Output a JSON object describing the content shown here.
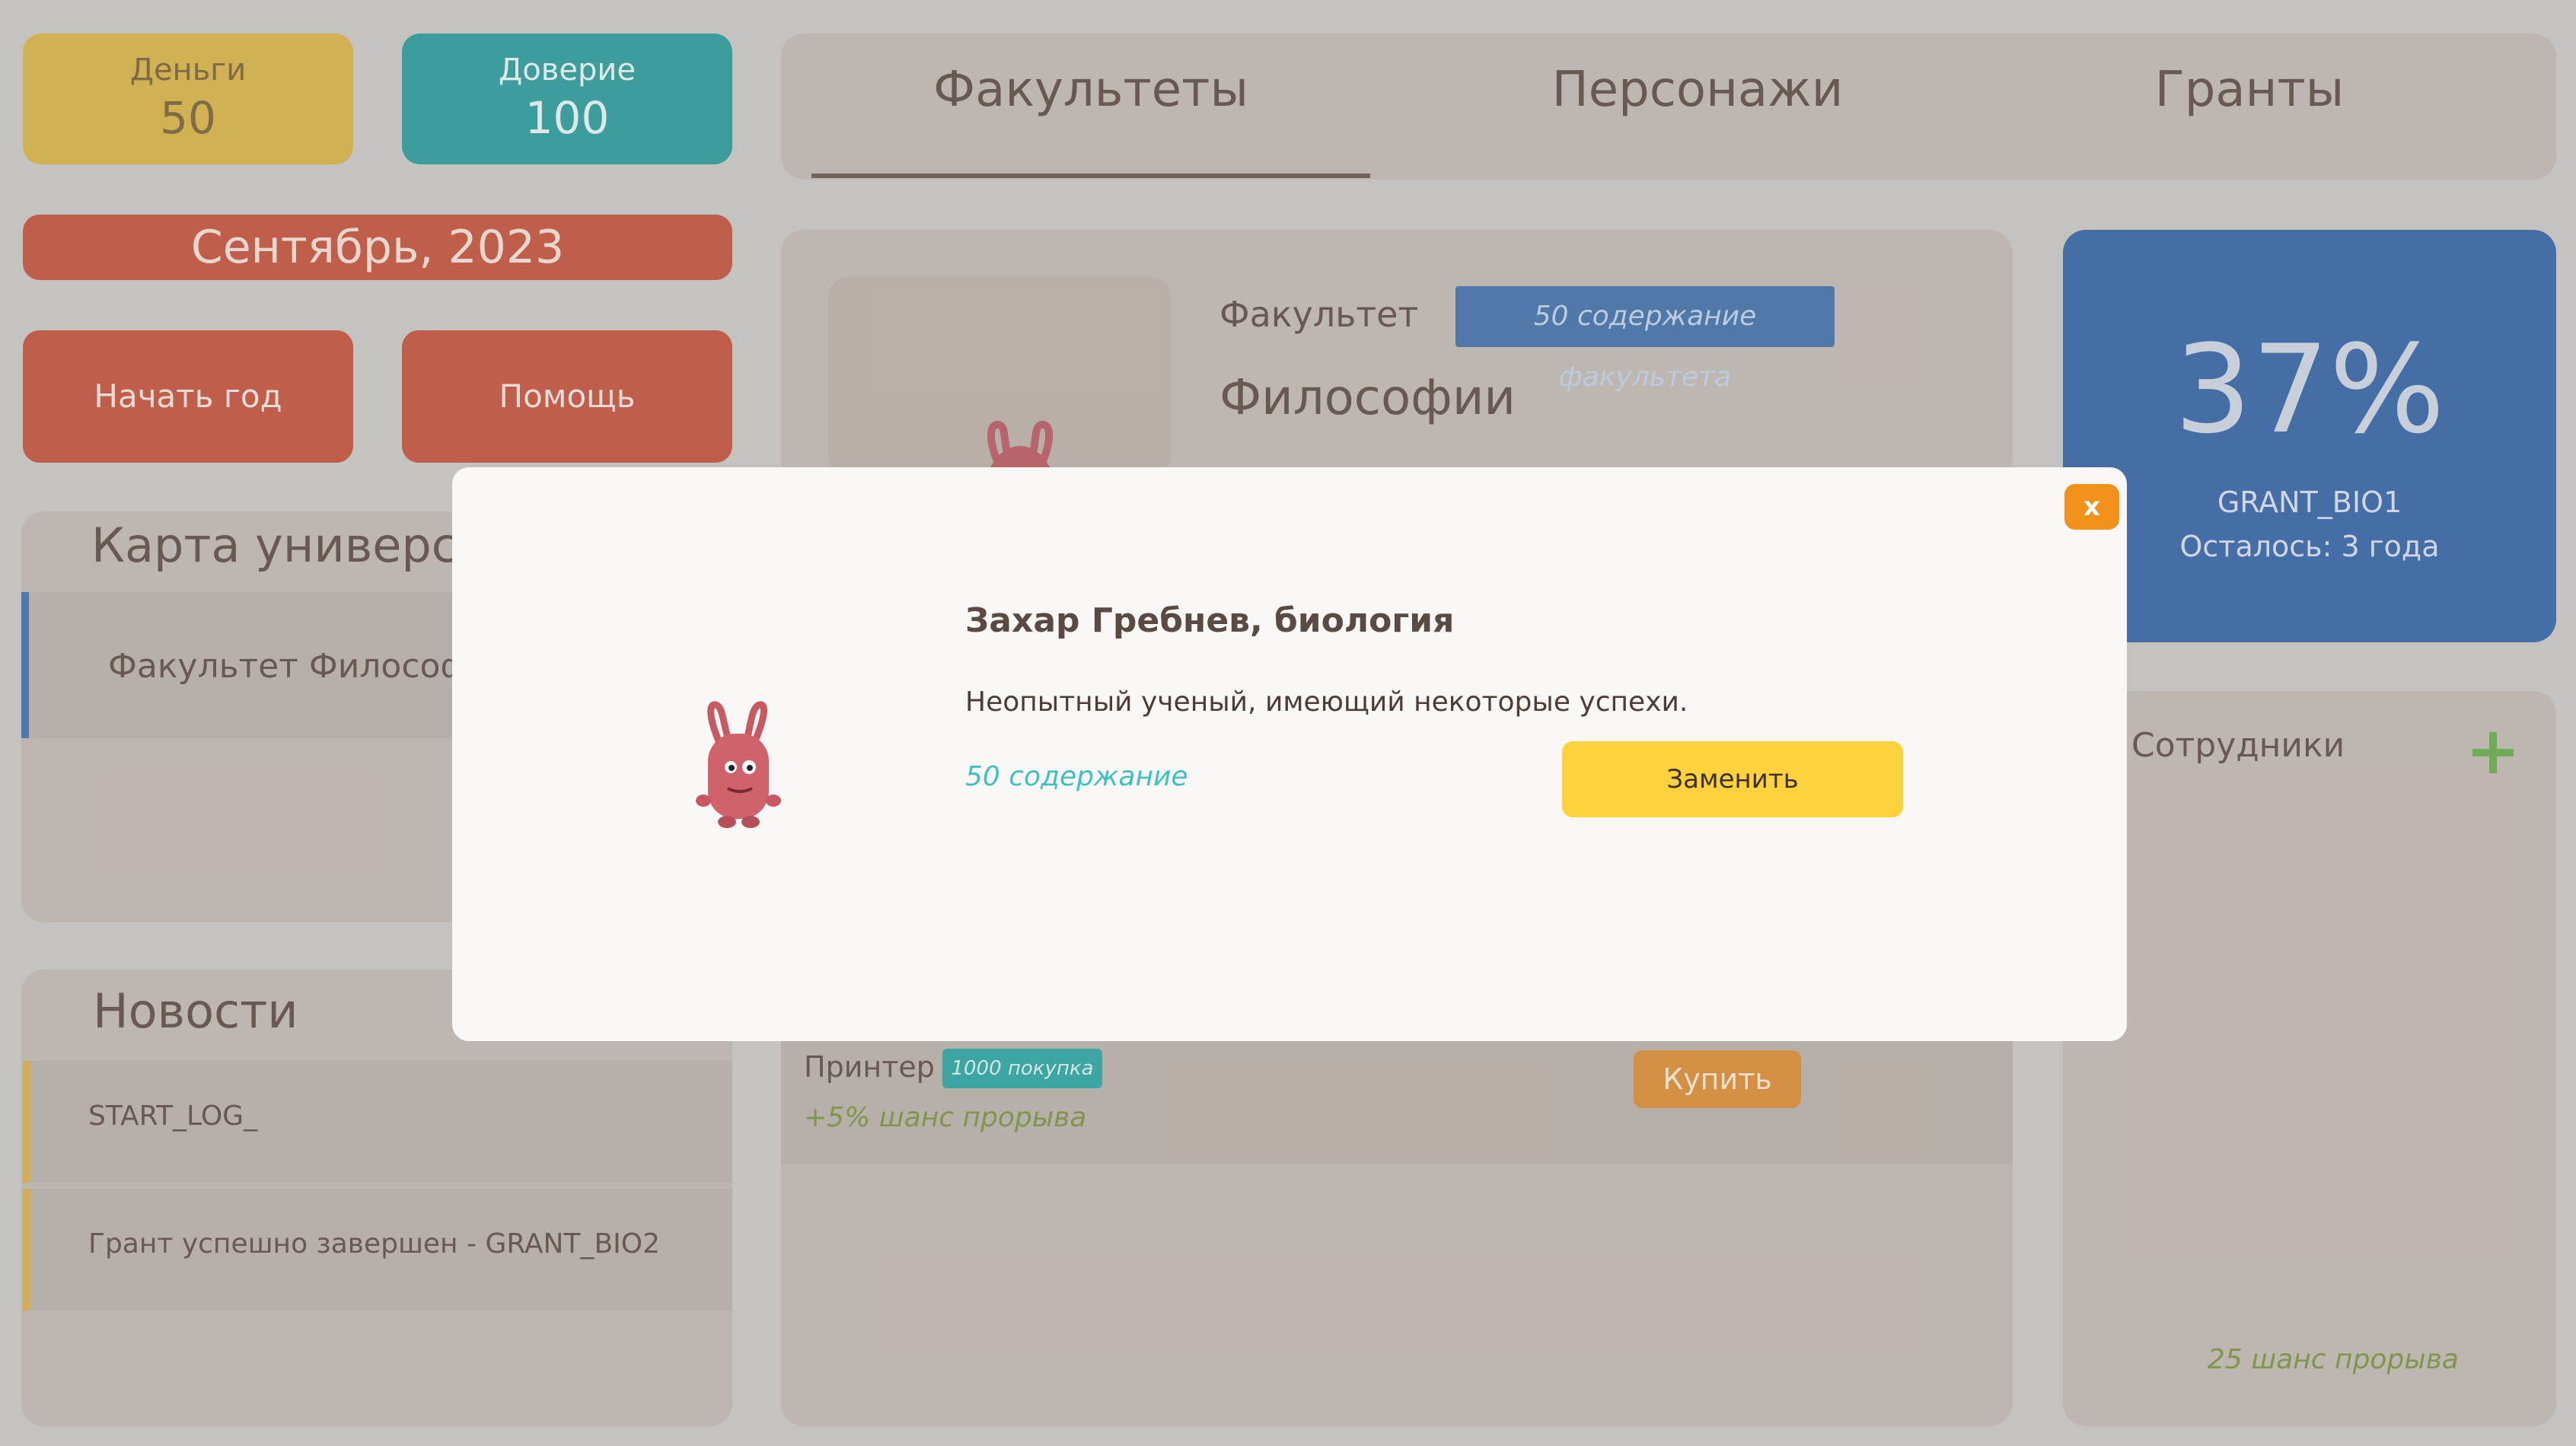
{
  "stats": {
    "money_label": "Деньги",
    "money_value": "50",
    "trust_label": "Доверие",
    "trust_value": "100"
  },
  "date": "Сентябрь, 2023",
  "buttons": {
    "start_year": "Начать год",
    "help": "Помощь"
  },
  "map": {
    "title": "Карта университета",
    "items": [
      "Факультет Философии"
    ]
  },
  "news": {
    "title": "Новости",
    "items": [
      "START_LOG_",
      "Грант успешно завершен - GRANT_BIO2"
    ]
  },
  "tabs": [
    "Факультеты",
    "Персонажи",
    "Гранты"
  ],
  "faculty": {
    "label": "Факультет",
    "badge": "50 содержание факультета",
    "name": "Философии"
  },
  "equipment": {
    "name": "Принтер",
    "badge": "1000 покупка",
    "chance": "+5% шанс прорыва",
    "buy_label": "Купить"
  },
  "grant": {
    "percent": "37%",
    "name": "GRANT_BIO1",
    "remaining": "Осталось: 3 года"
  },
  "staff": {
    "title": "Сотрудники",
    "chance": "25 шанс прорыва"
  },
  "modal": {
    "close_label": "x",
    "name": "Захар Гребнев, биология",
    "description": "Неопытный ученый, имеющий некоторые успехи.",
    "upkeep": "50 содержание",
    "replace_label": "Заменить"
  },
  "colors": {
    "money": "#d4ac37",
    "trust": "#159393",
    "red": "#bd4229",
    "grant": "#2157a0",
    "accent_orange": "#f2901c",
    "replace": "#fdd23c"
  },
  "icons": {
    "character": "pink-monster-icon",
    "add": "plus-icon",
    "close": "close-icon"
  }
}
